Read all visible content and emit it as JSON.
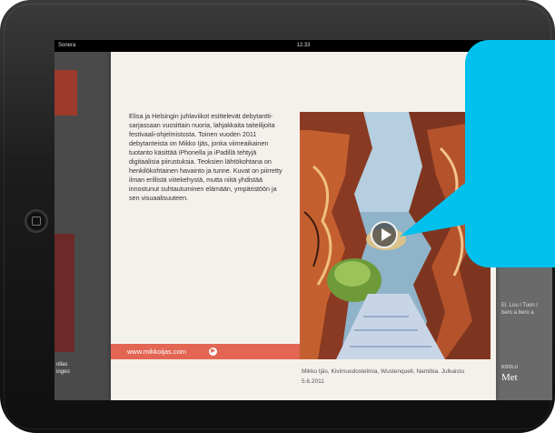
{
  "status_bar": {
    "carrier": "Sonera",
    "time": "12.33"
  },
  "background_left": {
    "text": "ollas ingeo"
  },
  "background_right": {
    "column_text": "El. Lou l Tuon l bero a bero a",
    "section_label": "KOOLU",
    "headline": "Met"
  },
  "article": {
    "intro": "Elisa ja Helsingin juhlaviikot esittelevät debytantti-sarjassaan vuosittain nuoria, lahjakkaita taiteilijoita festivaali-ohjelmistosta. Toinen vuoden 2011 debytanteista on Mikko Ijäs, jonka viimeaikainen tuotanto käsittää iPhonella ja iPadillä tehtyjä digitaalisia piirustuksia. Teoksien lähtökohtana on henkilökohtainen havainto ja tunne. Kuvat on piirretty ilman erillistä viitekehystä, mutta niitä yhdistää innostunut suhtautuminen elämään, ympäristöön ja sen visuaalisuuteen.",
    "link": "www.mikkoijas.com",
    "caption": "Mikko Ijäs, Kivimuodostelmia, Wustenquell, Namibia. Julkaistu 5.6.2011"
  },
  "colors": {
    "accent": "#e36553",
    "bubble": "#00c0ee",
    "device": "#1a1a1a"
  },
  "icons": [
    "home-button",
    "play-icon",
    "arrow-right-icon"
  ]
}
